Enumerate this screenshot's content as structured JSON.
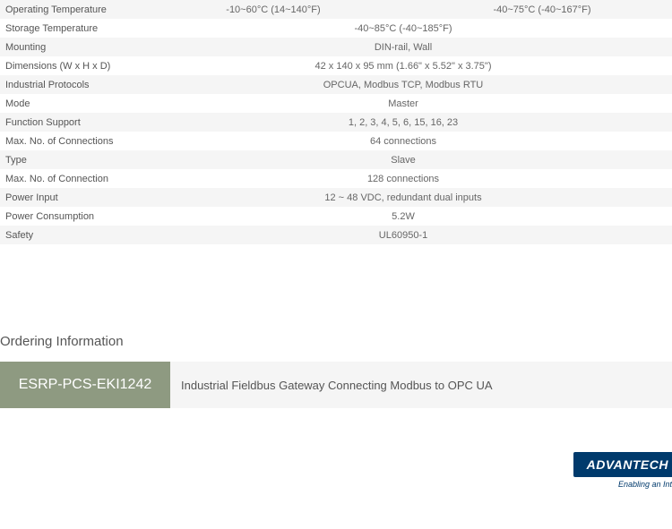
{
  "specs": [
    {
      "label": "Operating Temperature",
      "value1": "-10~60°C (14~140°F)",
      "value2": "-40~75°C (-40~167°F)"
    },
    {
      "label": "Storage Temperature",
      "value": "-40~85°C (-40~185°F)"
    },
    {
      "label": "Mounting",
      "value": "DIN-rail, Wall"
    },
    {
      "label": "Dimensions (W x H x D)",
      "value": "42 x 140 x 95 mm (1.66\" x 5.52\" x 3.75\")"
    },
    {
      "label": "Industrial Protocols",
      "value": "OPCUA, Modbus TCP, Modbus RTU"
    },
    {
      "label": "Mode",
      "value": "Master"
    },
    {
      "label": "Function Support",
      "value": "1, 2, 3, 4, 5, 6, 15, 16, 23"
    },
    {
      "label": "Max. No. of Connections",
      "value": "64 connections"
    },
    {
      "label": "Type",
      "value": "Slave"
    },
    {
      "label": "Max. No. of Connection",
      "value": "128 connections"
    },
    {
      "label": "Power Input",
      "value": "12 ~ 48 VDC, redundant dual inputs"
    },
    {
      "label": "Power Consumption",
      "value": "5.2W"
    },
    {
      "label": "Safety",
      "value": "UL60950-1"
    }
  ],
  "ordering": {
    "title": "Ordering Information",
    "code": "ESRP-PCS-EKI1242",
    "desc": "Industrial Fieldbus Gateway Connecting Modbus to OPC UA"
  },
  "logo": {
    "main": "ADVANTECH",
    "sub": "Enabling an Int"
  }
}
